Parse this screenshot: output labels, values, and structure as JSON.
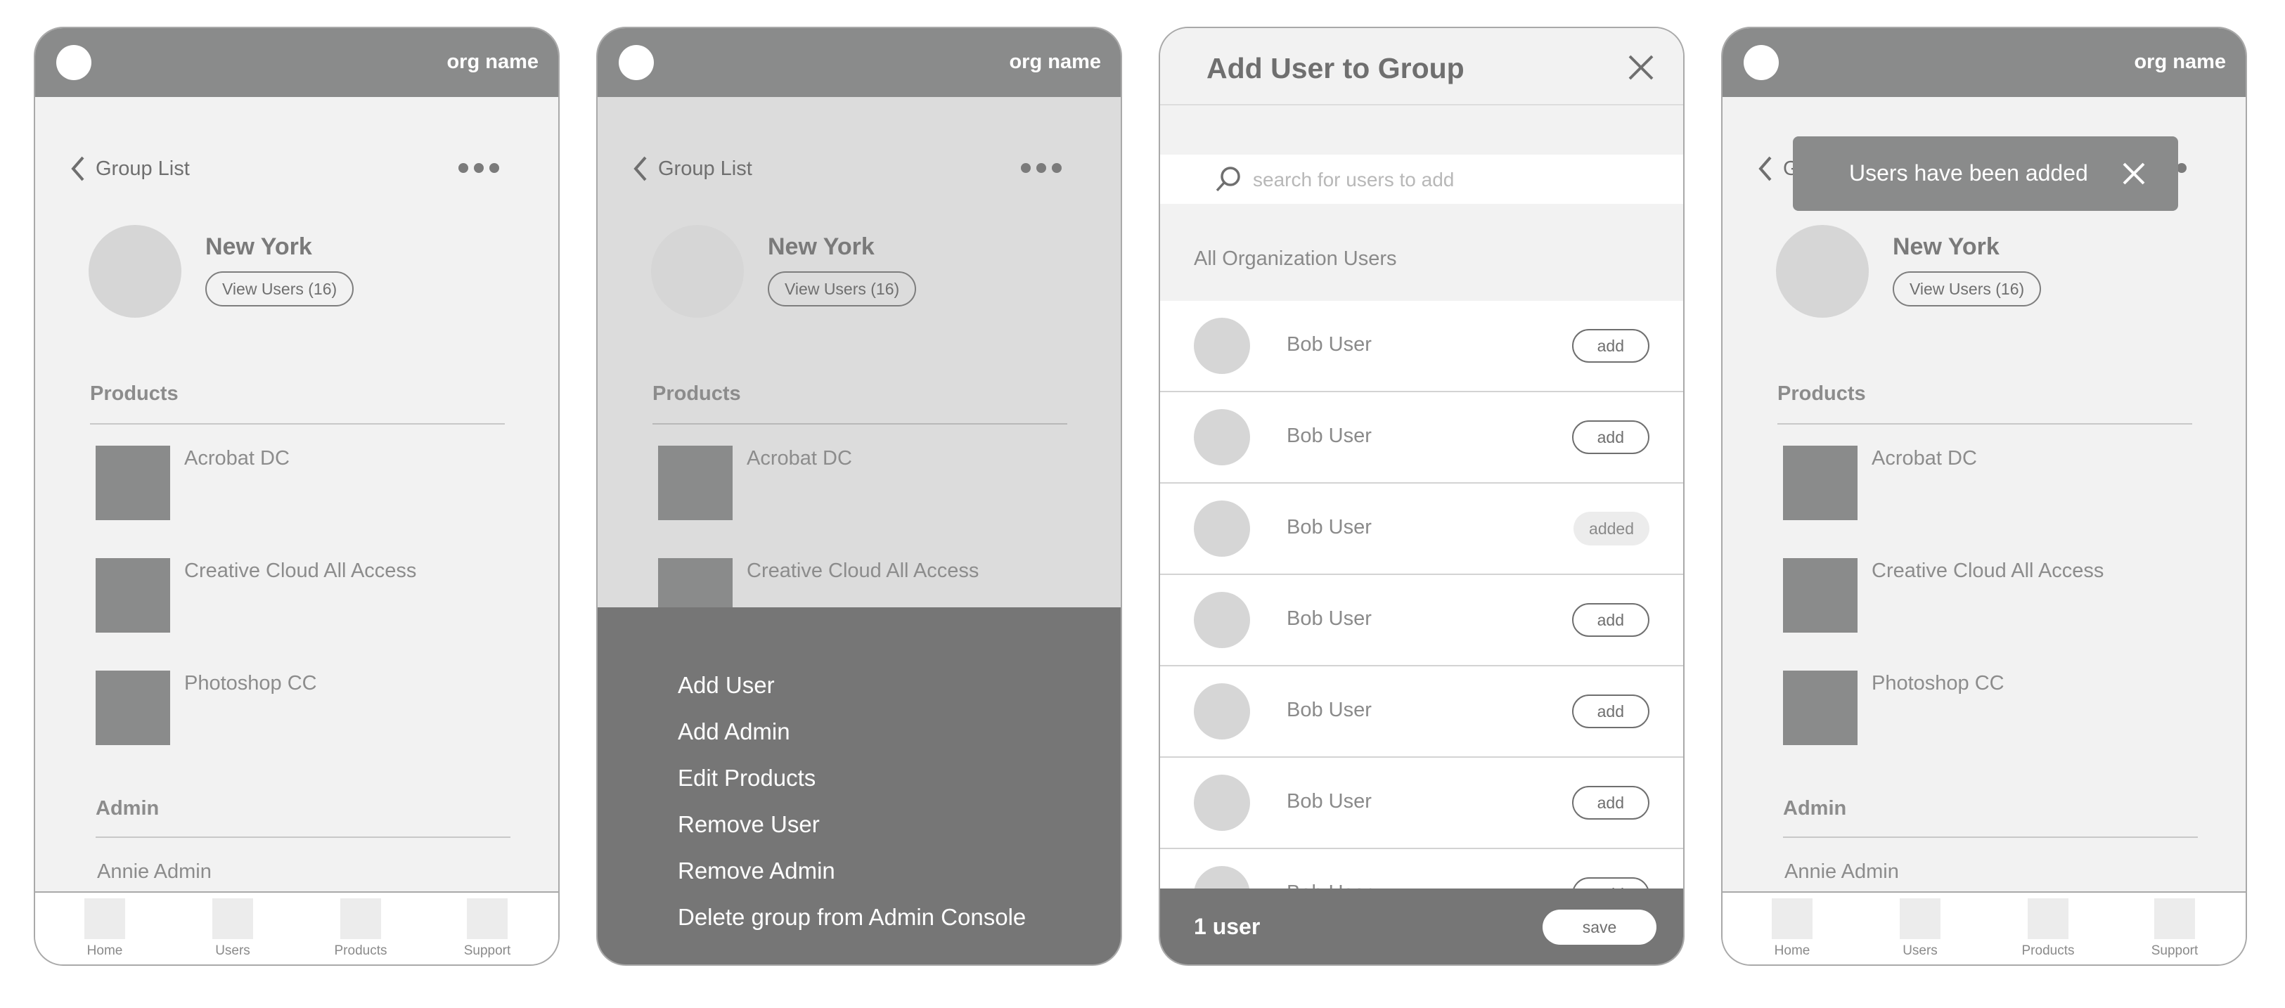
{
  "header": {
    "org_name": "org name"
  },
  "group": {
    "back_label": "Group List",
    "name": "New York",
    "view_users_label": "View Users (16)",
    "products_heading": "Products",
    "products": [
      "Acrobat DC",
      "Creative Cloud All Access",
      "Photoshop CC"
    ],
    "admin_heading": "Admin",
    "admin_name": "Annie Admin"
  },
  "tabs": [
    "Home",
    "Users",
    "Products",
    "Support"
  ],
  "action_menu": {
    "items": [
      "Add User",
      "Add Admin",
      "Edit Products",
      "Remove User",
      "Remove Admin",
      "Delete group from Admin Console"
    ]
  },
  "add_user_modal": {
    "title": "Add User to Group",
    "search_placeholder": "search for users to add",
    "section_label": "All Organization Users",
    "users": [
      {
        "name": "Bob User",
        "action": "add"
      },
      {
        "name": "Bob User",
        "action": "add"
      },
      {
        "name": "Bob User",
        "action": "added"
      },
      {
        "name": "Bob User",
        "action": "add"
      },
      {
        "name": "Bob User",
        "action": "add"
      },
      {
        "name": "Bob User",
        "action": "add"
      },
      {
        "name": "Bob User",
        "action": "add"
      }
    ],
    "footer_count": "1 user",
    "save_label": "save"
  },
  "toast": {
    "message": "Users have been added"
  },
  "colors": {
    "topbar": "#8a8b8b",
    "menu": "#767676",
    "thumb": "#8a8b8b"
  }
}
